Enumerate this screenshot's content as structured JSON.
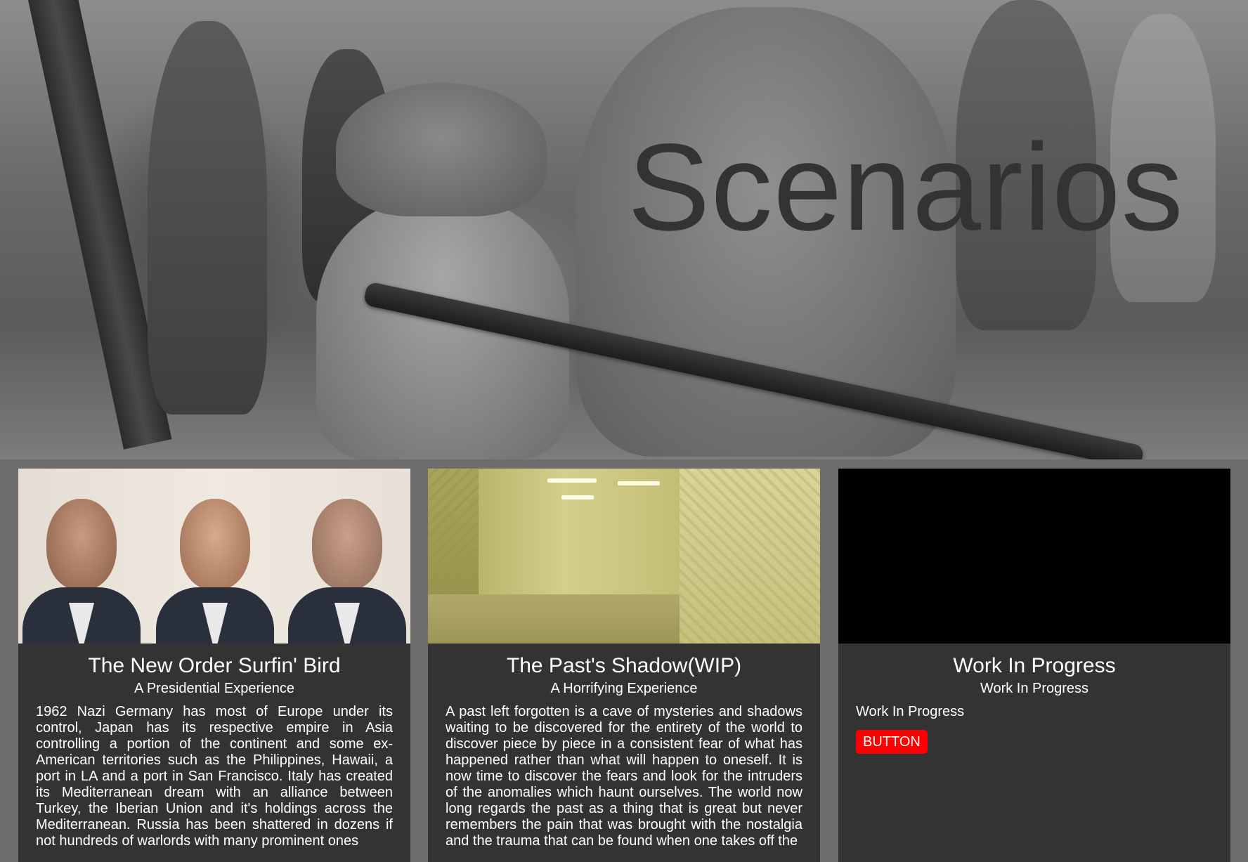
{
  "hero": {
    "title": "Scenarios"
  },
  "cards": [
    {
      "title": "The New Order Surfin' Bird",
      "subtitle": "A Presidential Experience",
      "body": "1962 Nazi Germany has most of Europe under its control, Japan has its respective empire in Asia controlling a portion of the continent and some ex-American territories such as the Philippines, Hawaii, a port in LA and a port in San Francisco. Italy has created its Mediterranean dream with an alliance between Turkey, the Iberian Union and it's holdings across the Mediterranean. Russia has been shattered in dozens if not hundreds of warlords with many prominent ones"
    },
    {
      "title": "The Past's Shadow(WIP)",
      "subtitle": "A Horrifying Experience",
      "body": "A past left forgotten is a cave of mysteries and shadows waiting to be discovered for the entirety of the world to discover piece by piece in a consistent fear of what has happened rather than what will happen to oneself. It is now time to discover the fears and look for the intruders of the anomalies which haunt ourselves. The world now long regards the past as a thing that is great but never remembers the pain that was brought with the nostalgia and the trauma that can be found when one takes off the"
    },
    {
      "title": "Work In Progress",
      "subtitle": "Work In Progress",
      "body": "Work In Progress",
      "button_label": "BUTTON"
    }
  ],
  "colors": {
    "page_background": "#6e6d6d",
    "card_background": "#333333",
    "hero_title": "#333333",
    "button_background": "#ff0000",
    "text": "#ffffff"
  }
}
